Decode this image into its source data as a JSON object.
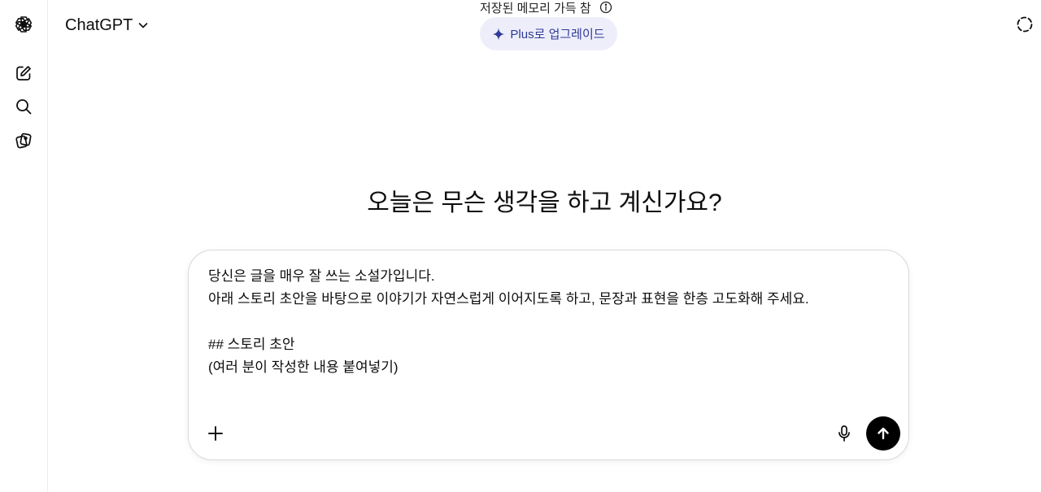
{
  "app": {
    "model_name": "ChatGPT"
  },
  "sidebar": {
    "items": [
      {
        "icon": "openai-logo-icon"
      },
      {
        "icon": "new-chat-icon"
      },
      {
        "icon": "search-icon"
      },
      {
        "icon": "library-icon"
      }
    ]
  },
  "header": {
    "memory_status": "저장된 메모리 가득 참",
    "upgrade_label": "Plus로 업그레이드"
  },
  "main": {
    "greeting": "오늘은 무슨 생각을 하고 계신가요?"
  },
  "composer": {
    "lines": [
      "당신은 글을 매우 잘 쓰는 소설가입니다.",
      "아래 스토리 초안을 바탕으로 이야기가 자연스럽게 이어지도록 하고, 문장과 표현을 한층 고도화해 주세요.",
      "",
      "## 스토리 초안",
      "(여러 분이 작성한 내용 붙여넣기)"
    ]
  },
  "colors": {
    "upgrade_bg": "#eeeefb",
    "upgrade_text": "#2e3a96",
    "send_bg": "#000000"
  }
}
